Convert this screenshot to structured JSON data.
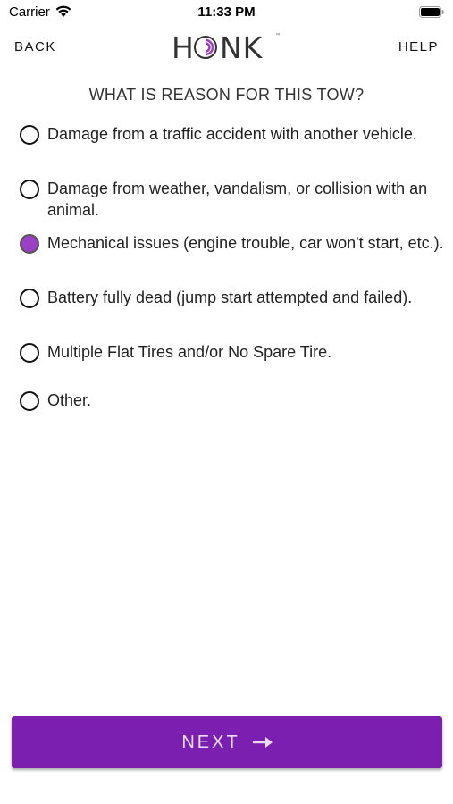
{
  "status_bar": {
    "carrier": "Carrier",
    "time": "11:33 PM"
  },
  "nav": {
    "back_label": "BACK",
    "help_label": "HELP",
    "logo_text": "HONK",
    "logo_tm": "™"
  },
  "question": "WHAT IS REASON FOR THIS TOW?",
  "options": [
    {
      "label": "Damage from a traffic accident with another vehicle.",
      "selected": false
    },
    {
      "label": "Damage from weather, vandalism, or collision with an animal.",
      "selected": false
    },
    {
      "label": "Mechanical issues (engine trouble, car won't start, etc.).",
      "selected": true
    },
    {
      "label": "Battery fully dead (jump start attempted and failed).",
      "selected": false
    },
    {
      "label": "Multiple Flat Tires and/or No Spare Tire.",
      "selected": false
    },
    {
      "label": "Other.",
      "selected": false
    }
  ],
  "next_button": {
    "label": "NEXT",
    "icon": "arrow-right-icon"
  },
  "colors": {
    "accent": "#7a1fb0",
    "selected_radio": "#9b3fc4"
  }
}
